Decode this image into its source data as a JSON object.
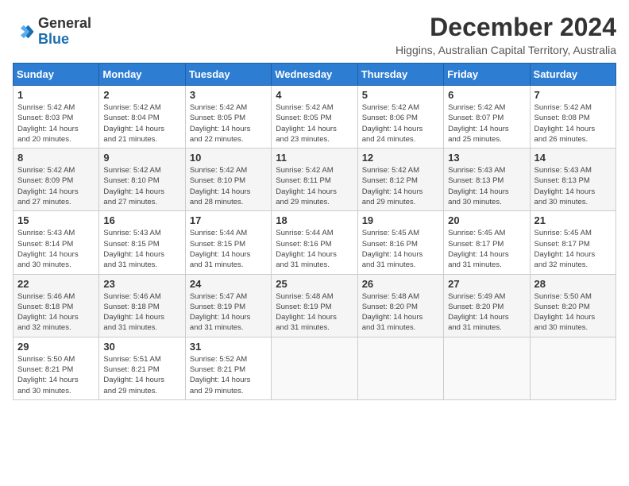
{
  "logo": {
    "general": "General",
    "blue": "Blue"
  },
  "title": "December 2024",
  "subtitle": "Higgins, Australian Capital Territory, Australia",
  "days_header": [
    "Sunday",
    "Monday",
    "Tuesday",
    "Wednesday",
    "Thursday",
    "Friday",
    "Saturday"
  ],
  "weeks": [
    [
      {
        "day": "1",
        "info": "Sunrise: 5:42 AM\nSunset: 8:03 PM\nDaylight: 14 hours\nand 20 minutes."
      },
      {
        "day": "2",
        "info": "Sunrise: 5:42 AM\nSunset: 8:04 PM\nDaylight: 14 hours\nand 21 minutes."
      },
      {
        "day": "3",
        "info": "Sunrise: 5:42 AM\nSunset: 8:05 PM\nDaylight: 14 hours\nand 22 minutes."
      },
      {
        "day": "4",
        "info": "Sunrise: 5:42 AM\nSunset: 8:05 PM\nDaylight: 14 hours\nand 23 minutes."
      },
      {
        "day": "5",
        "info": "Sunrise: 5:42 AM\nSunset: 8:06 PM\nDaylight: 14 hours\nand 24 minutes."
      },
      {
        "day": "6",
        "info": "Sunrise: 5:42 AM\nSunset: 8:07 PM\nDaylight: 14 hours\nand 25 minutes."
      },
      {
        "day": "7",
        "info": "Sunrise: 5:42 AM\nSunset: 8:08 PM\nDaylight: 14 hours\nand 26 minutes."
      }
    ],
    [
      {
        "day": "8",
        "info": "Sunrise: 5:42 AM\nSunset: 8:09 PM\nDaylight: 14 hours\nand 27 minutes."
      },
      {
        "day": "9",
        "info": "Sunrise: 5:42 AM\nSunset: 8:10 PM\nDaylight: 14 hours\nand 27 minutes."
      },
      {
        "day": "10",
        "info": "Sunrise: 5:42 AM\nSunset: 8:10 PM\nDaylight: 14 hours\nand 28 minutes."
      },
      {
        "day": "11",
        "info": "Sunrise: 5:42 AM\nSunset: 8:11 PM\nDaylight: 14 hours\nand 29 minutes."
      },
      {
        "day": "12",
        "info": "Sunrise: 5:42 AM\nSunset: 8:12 PM\nDaylight: 14 hours\nand 29 minutes."
      },
      {
        "day": "13",
        "info": "Sunrise: 5:43 AM\nSunset: 8:13 PM\nDaylight: 14 hours\nand 30 minutes."
      },
      {
        "day": "14",
        "info": "Sunrise: 5:43 AM\nSunset: 8:13 PM\nDaylight: 14 hours\nand 30 minutes."
      }
    ],
    [
      {
        "day": "15",
        "info": "Sunrise: 5:43 AM\nSunset: 8:14 PM\nDaylight: 14 hours\nand 30 minutes."
      },
      {
        "day": "16",
        "info": "Sunrise: 5:43 AM\nSunset: 8:15 PM\nDaylight: 14 hours\nand 31 minutes."
      },
      {
        "day": "17",
        "info": "Sunrise: 5:44 AM\nSunset: 8:15 PM\nDaylight: 14 hours\nand 31 minutes."
      },
      {
        "day": "18",
        "info": "Sunrise: 5:44 AM\nSunset: 8:16 PM\nDaylight: 14 hours\nand 31 minutes."
      },
      {
        "day": "19",
        "info": "Sunrise: 5:45 AM\nSunset: 8:16 PM\nDaylight: 14 hours\nand 31 minutes."
      },
      {
        "day": "20",
        "info": "Sunrise: 5:45 AM\nSunset: 8:17 PM\nDaylight: 14 hours\nand 31 minutes."
      },
      {
        "day": "21",
        "info": "Sunrise: 5:45 AM\nSunset: 8:17 PM\nDaylight: 14 hours\nand 32 minutes."
      }
    ],
    [
      {
        "day": "22",
        "info": "Sunrise: 5:46 AM\nSunset: 8:18 PM\nDaylight: 14 hours\nand 32 minutes."
      },
      {
        "day": "23",
        "info": "Sunrise: 5:46 AM\nSunset: 8:18 PM\nDaylight: 14 hours\nand 31 minutes."
      },
      {
        "day": "24",
        "info": "Sunrise: 5:47 AM\nSunset: 8:19 PM\nDaylight: 14 hours\nand 31 minutes."
      },
      {
        "day": "25",
        "info": "Sunrise: 5:48 AM\nSunset: 8:19 PM\nDaylight: 14 hours\nand 31 minutes."
      },
      {
        "day": "26",
        "info": "Sunrise: 5:48 AM\nSunset: 8:20 PM\nDaylight: 14 hours\nand 31 minutes."
      },
      {
        "day": "27",
        "info": "Sunrise: 5:49 AM\nSunset: 8:20 PM\nDaylight: 14 hours\nand 31 minutes."
      },
      {
        "day": "28",
        "info": "Sunrise: 5:50 AM\nSunset: 8:20 PM\nDaylight: 14 hours\nand 30 minutes."
      }
    ],
    [
      {
        "day": "29",
        "info": "Sunrise: 5:50 AM\nSunset: 8:21 PM\nDaylight: 14 hours\nand 30 minutes."
      },
      {
        "day": "30",
        "info": "Sunrise: 5:51 AM\nSunset: 8:21 PM\nDaylight: 14 hours\nand 29 minutes."
      },
      {
        "day": "31",
        "info": "Sunrise: 5:52 AM\nSunset: 8:21 PM\nDaylight: 14 hours\nand 29 minutes."
      },
      null,
      null,
      null,
      null
    ]
  ]
}
